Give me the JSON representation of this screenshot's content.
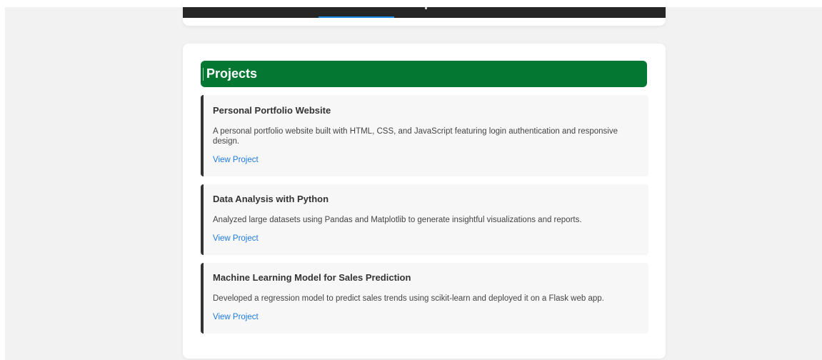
{
  "projects_section": {
    "title": "Projects",
    "items": [
      {
        "title": "Personal Portfolio Website",
        "description": "A personal portfolio website built with HTML, CSS, and JavaScript featuring login authentication and responsive design.",
        "link_label": "View Project"
      },
      {
        "title": "Data Analysis with Python",
        "description": "Analyzed large datasets using Pandas and Matplotlib to generate insightful visualizations and reports.",
        "link_label": "View Project"
      },
      {
        "title": "Machine Learning Model for Sales Prediction",
        "description": "Developed a regression model to predict sales trends using scikit-learn and deployed it on a Flask web app.",
        "link_label": "View Project"
      }
    ]
  },
  "colors": {
    "header_green": "#047733",
    "link_blue": "#1e7be0",
    "nav_dark": "#262626",
    "accent_border": "#333333",
    "page_background": "#f2f2f2"
  }
}
